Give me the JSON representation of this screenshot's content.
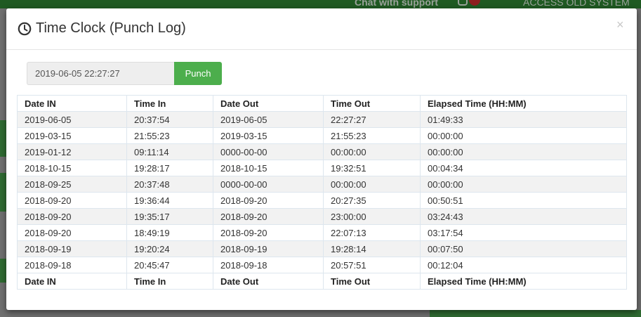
{
  "background": {
    "chat_label": "Chat with support",
    "old_system_label": "ACCESS OLD SYSTEM"
  },
  "modal": {
    "title": "Time Clock (Punch Log)",
    "close_symbol": "×",
    "icons": {
      "title": "clock-icon",
      "close": "close-icon"
    }
  },
  "punch": {
    "datetime_value": "2019-06-05 22:27:27",
    "button_label": "Punch"
  },
  "table": {
    "headers": [
      "Date IN",
      "Time In",
      "Date Out",
      "Time Out",
      "Elapsed Time (HH:MM)"
    ],
    "rows": [
      [
        "2019-06-05",
        "20:37:54",
        "2019-06-05",
        "22:27:27",
        "01:49:33"
      ],
      [
        "2019-03-15",
        "21:55:23",
        "2019-03-15",
        "21:55:23",
        "00:00:00"
      ],
      [
        "2019-01-12",
        "09:11:14",
        "0000-00-00",
        "00:00:00",
        "00:00:00"
      ],
      [
        "2018-10-15",
        "19:28:17",
        "2018-10-15",
        "19:32:51",
        "00:04:34"
      ],
      [
        "2018-09-25",
        "20:37:48",
        "0000-00-00",
        "00:00:00",
        "00:00:00"
      ],
      [
        "2018-09-20",
        "19:36:44",
        "2018-09-20",
        "20:27:35",
        "00:50:51"
      ],
      [
        "2018-09-20",
        "19:35:17",
        "2018-09-20",
        "23:00:00",
        "03:24:43"
      ],
      [
        "2018-09-20",
        "18:49:19",
        "2018-09-20",
        "22:07:13",
        "03:17:54"
      ],
      [
        "2018-09-19",
        "19:20:24",
        "2018-09-19",
        "19:28:14",
        "00:07:50"
      ],
      [
        "2018-09-18",
        "20:45:47",
        "2018-09-18",
        "20:57:51",
        "00:12:04"
      ]
    ]
  },
  "colors": {
    "punch_button": "#4cae4c",
    "background_green": "#1f5a22",
    "overlay": "#6f6f6f"
  }
}
